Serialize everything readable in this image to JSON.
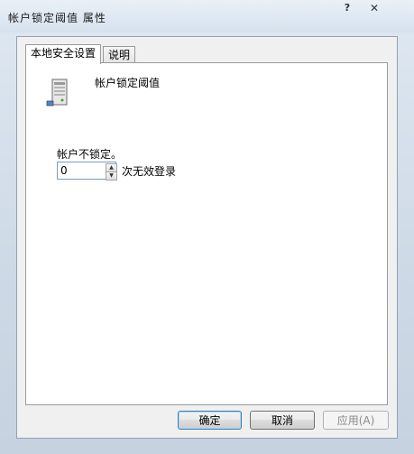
{
  "window": {
    "title": "帐户锁定阈值 属性",
    "help_label": "?",
    "close_label": "✕"
  },
  "tabs": [
    {
      "label": "本地安全设置",
      "active": true
    },
    {
      "label": "说明",
      "active": false
    }
  ],
  "panel": {
    "icon": "server-icon",
    "policy_name": "帐户锁定阈值",
    "field_label": "帐户不锁定。",
    "value": "0",
    "unit": "次无效登录"
  },
  "buttons": {
    "ok": "确定",
    "cancel": "取消",
    "apply": "应用(A)"
  },
  "colors": {
    "selection": "#3399ff",
    "default_button_border": "#3c7fb1"
  }
}
